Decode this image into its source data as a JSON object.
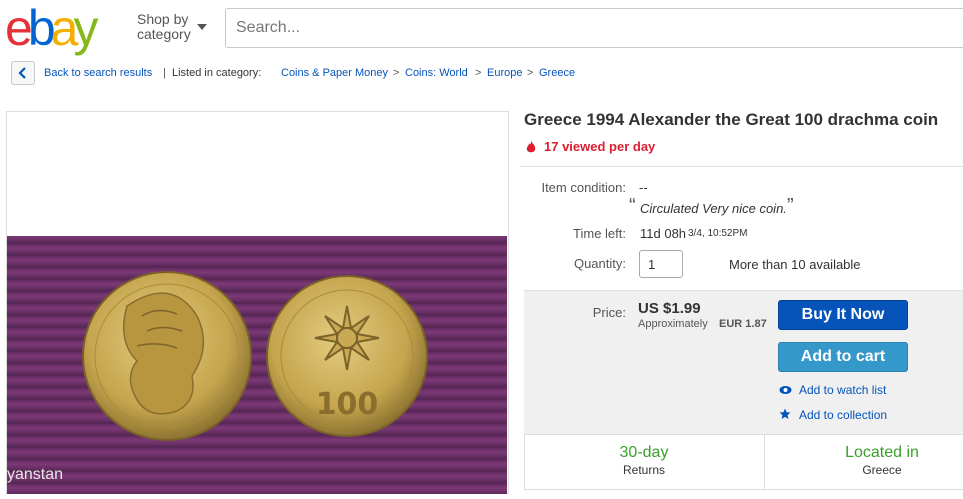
{
  "header": {
    "logo_letters": [
      "e",
      "b",
      "a",
      "y"
    ],
    "logo_colors": [
      "#e53238",
      "#0064d2",
      "#f5af02",
      "#86b817"
    ],
    "shop_by_line1": "Shop by",
    "shop_by_line2": "category",
    "search_placeholder": "Search..."
  },
  "breadcrumb": {
    "back_label": "Back to search results",
    "divider": "|",
    "listed_in": "Listed in category:",
    "items": [
      "Coins & Paper Money",
      "Coins: World",
      "Europe",
      "Greece"
    ],
    "sep": ">"
  },
  "image": {
    "watermark": "yanstan"
  },
  "item": {
    "title": "Greece 1994 Alexander the Great 100 drachma coin",
    "viewed": "17 viewed per day",
    "condition_label": "Item condition:",
    "condition_value": "--",
    "condition_quote_open": "“",
    "condition_note": "Circulated Very nice coin.",
    "condition_quote_close": "”",
    "time_left_label": "Time left:",
    "time_left_value": "11d 08h",
    "time_left_date": "3/4, 10:52PM",
    "quantity_label": "Quantity:",
    "quantity_value": "1",
    "available": "More than 10 available"
  },
  "price": {
    "label": "Price:",
    "value": "US $1.99",
    "approx_prefix": "Approximately",
    "approx_value": "EUR 1.87"
  },
  "actions": {
    "buy_now": "Buy It Now",
    "add_to_cart": "Add to cart",
    "watch": "Add to watch list",
    "collection": "Add to collection"
  },
  "info": {
    "returns_big": "30-day",
    "returns_small": "Returns",
    "location_big": "Located in",
    "location_small": "Greece"
  },
  "colors": {
    "link": "#0654ba",
    "buy_now_bg": "#0654ba",
    "add_cart_bg": "#3498ca",
    "viewed_red": "#dd1e31",
    "green": "#3a9f2b",
    "photo_purple": "#6a2f66",
    "coin_gold": "#c8a94e"
  }
}
